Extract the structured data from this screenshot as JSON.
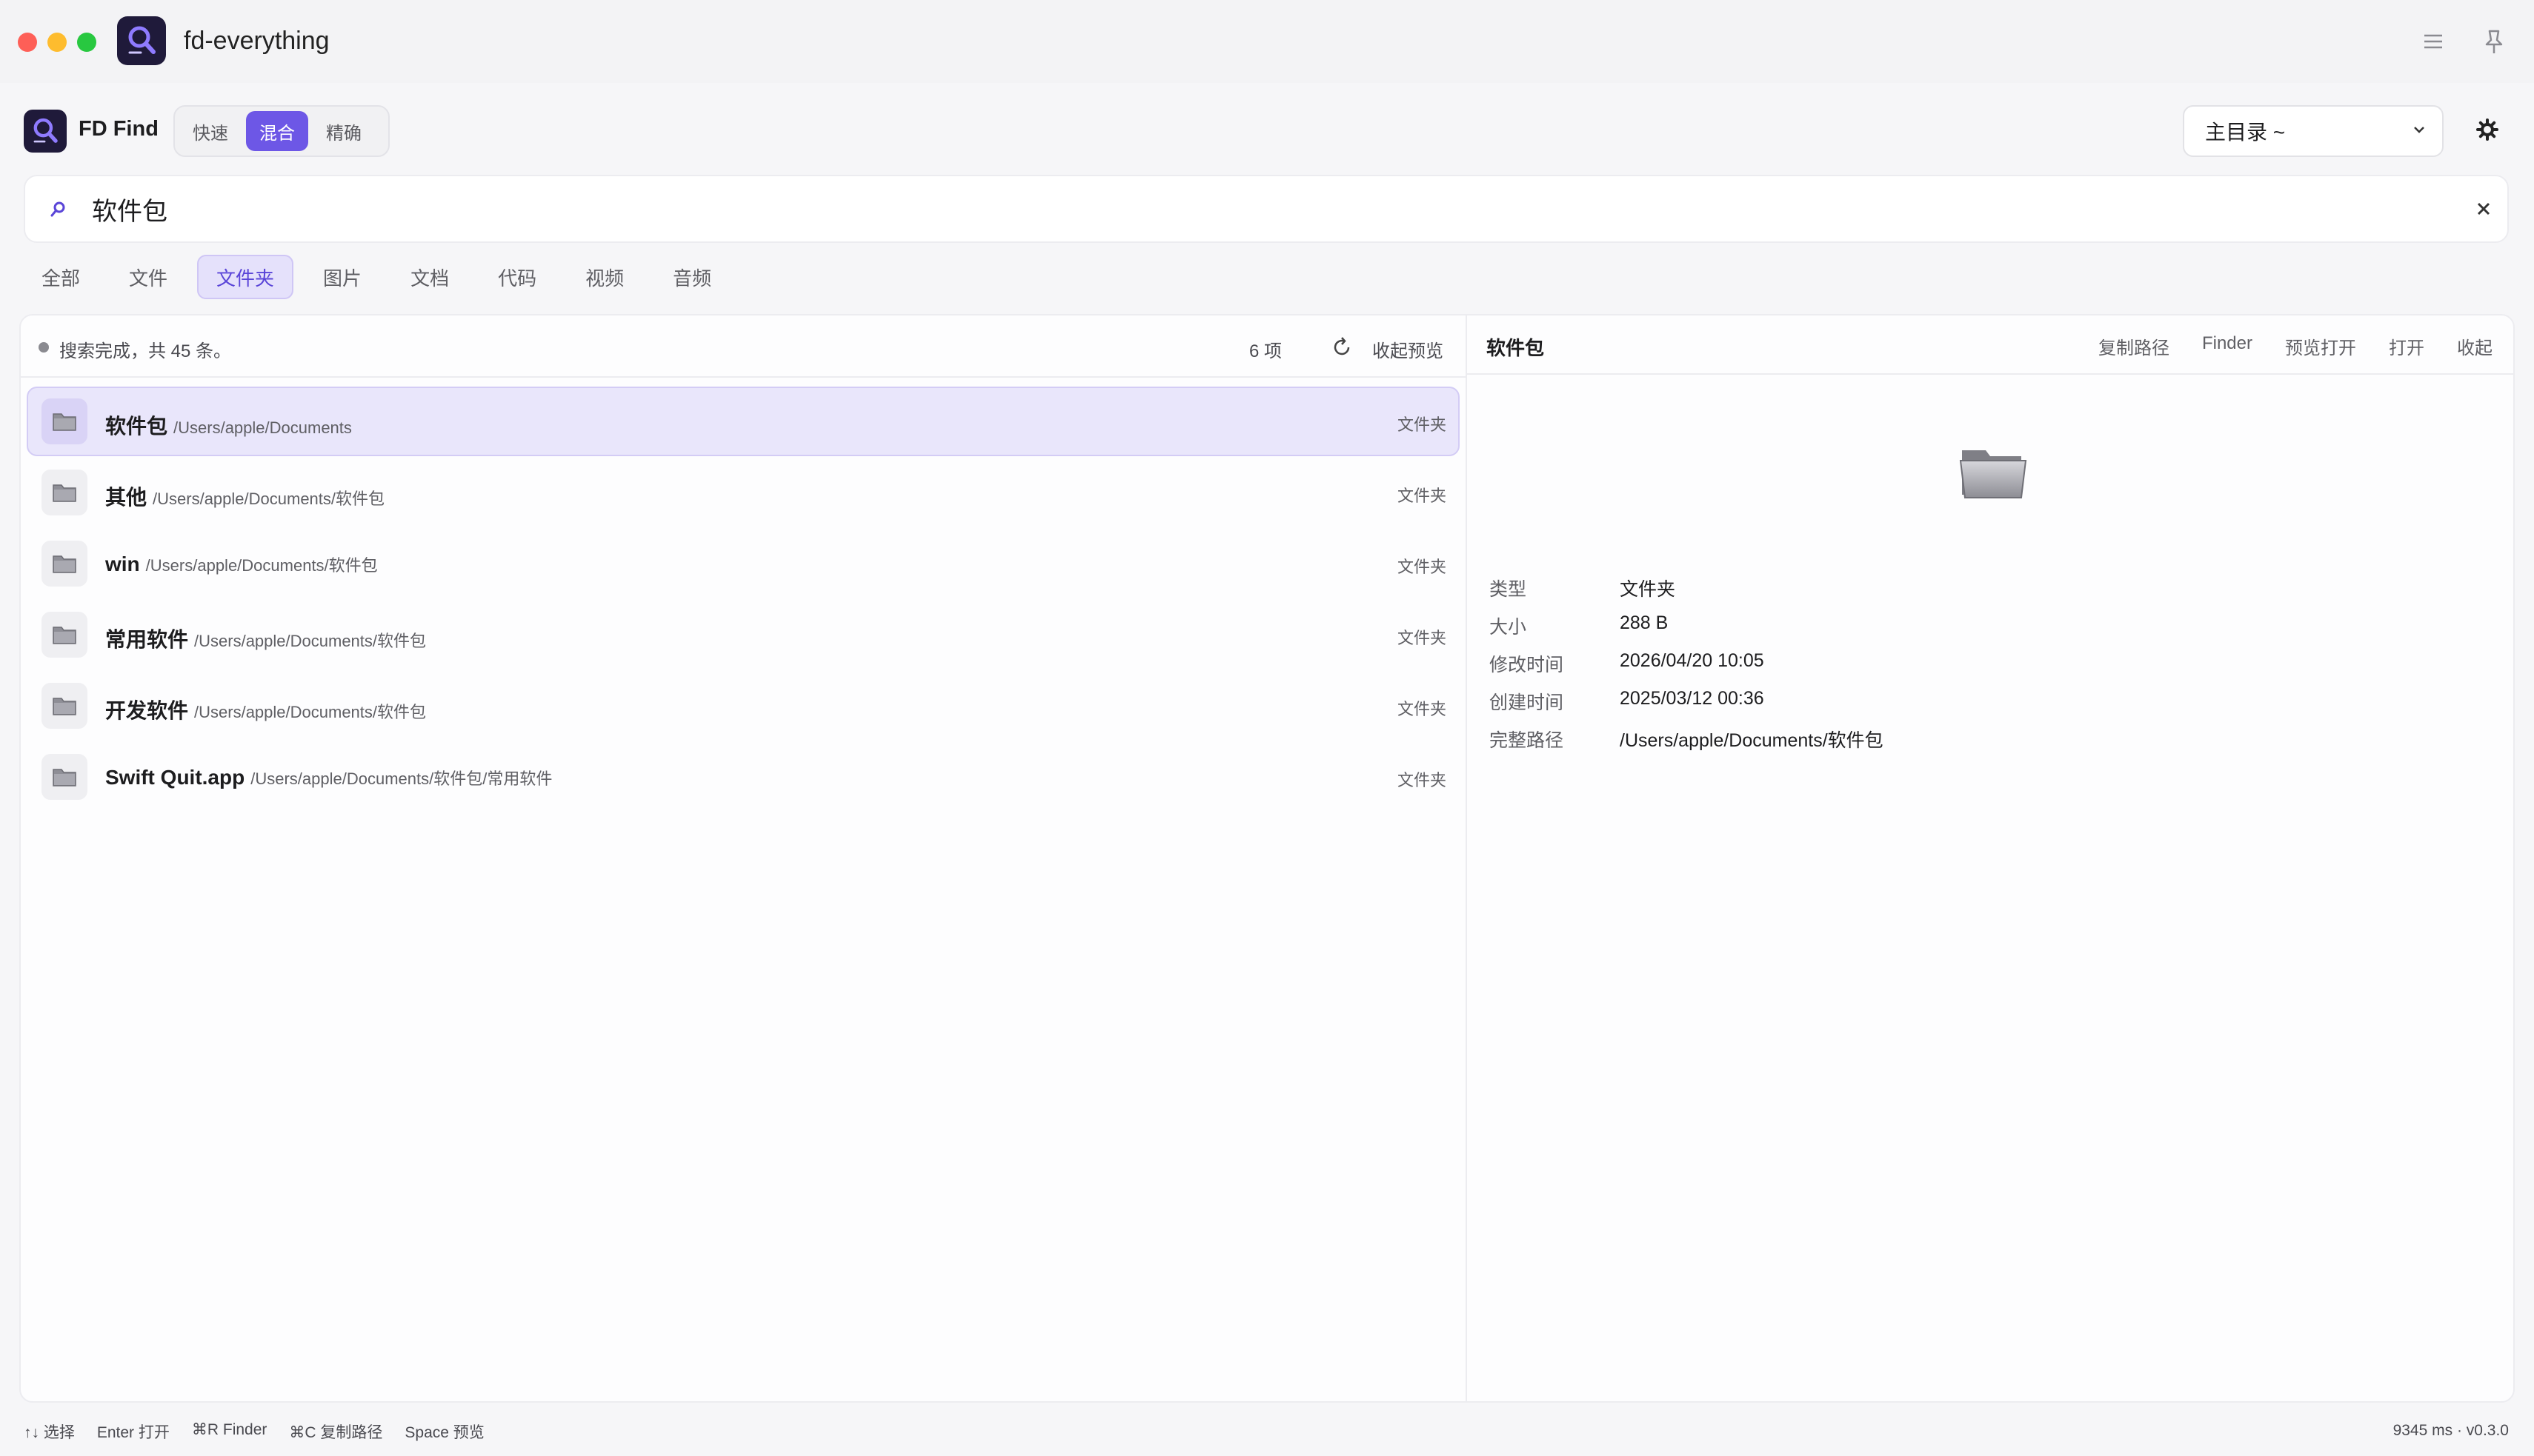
{
  "window": {
    "title": "fd-everything",
    "traffic_lights": [
      "close",
      "minimize",
      "maximize"
    ],
    "icons": [
      "menu-icon",
      "pin-icon"
    ]
  },
  "toolbar": {
    "brand": "FD Find",
    "modes": [
      {
        "label": "快速",
        "active": false
      },
      {
        "label": "混合",
        "active": true
      },
      {
        "label": "精确",
        "active": false
      }
    ],
    "scope_value": "主目录 ~",
    "settings_icon": "gear-icon"
  },
  "search": {
    "value": "软件包",
    "placeholder": ""
  },
  "tabs": [
    {
      "label": "全部",
      "active": false
    },
    {
      "label": "文件",
      "active": false
    },
    {
      "label": "文件夹",
      "active": true
    },
    {
      "label": "图片",
      "active": false
    },
    {
      "label": "文档",
      "active": false
    },
    {
      "label": "代码",
      "active": false
    },
    {
      "label": "视频",
      "active": false
    },
    {
      "label": "音频",
      "active": false
    }
  ],
  "results": {
    "status": "搜索完成，共 45 条。",
    "count": "6 项",
    "collapse_label": "收起预览",
    "rows": [
      {
        "name": "软件包",
        "path": "/Users/apple/Documents",
        "type": "文件夹",
        "selected": true
      },
      {
        "name": "其他",
        "path": "/Users/apple/Documents/软件包",
        "type": "文件夹",
        "selected": false
      },
      {
        "name": "win",
        "path": "/Users/apple/Documents/软件包",
        "type": "文件夹",
        "selected": false
      },
      {
        "name": "常用软件",
        "path": "/Users/apple/Documents/软件包",
        "type": "文件夹",
        "selected": false
      },
      {
        "name": "开发软件",
        "path": "/Users/apple/Documents/软件包",
        "type": "文件夹",
        "selected": false
      },
      {
        "name": "Swift Quit.app",
        "path": "/Users/apple/Documents/软件包/常用软件",
        "type": "文件夹",
        "selected": false
      }
    ]
  },
  "preview": {
    "title": "软件包",
    "actions": [
      "复制路径",
      "Finder",
      "预览打开",
      "打开",
      "收起"
    ],
    "info": [
      {
        "key": "类型",
        "value": "文件夹"
      },
      {
        "key": "大小",
        "value": "288 B"
      },
      {
        "key": "修改时间",
        "value": "2026/04/20 10:05"
      },
      {
        "key": "创建时间",
        "value": "2025/03/12 00:36"
      },
      {
        "key": "完整路径",
        "value": "/Users/apple/Documents/软件包"
      }
    ]
  },
  "footer": {
    "hints": [
      "↑↓ 选择",
      "Enter 打开",
      "⌘R Finder",
      "⌘C 复制路径",
      "Space 预览"
    ],
    "version": "9345 ms · v0.3.0"
  },
  "colors": {
    "accent": "#6d57e6",
    "selected_row": "#e9e6fb",
    "close": "#fe5f57",
    "minimize": "#febc2e",
    "maximize": "#28c840"
  }
}
